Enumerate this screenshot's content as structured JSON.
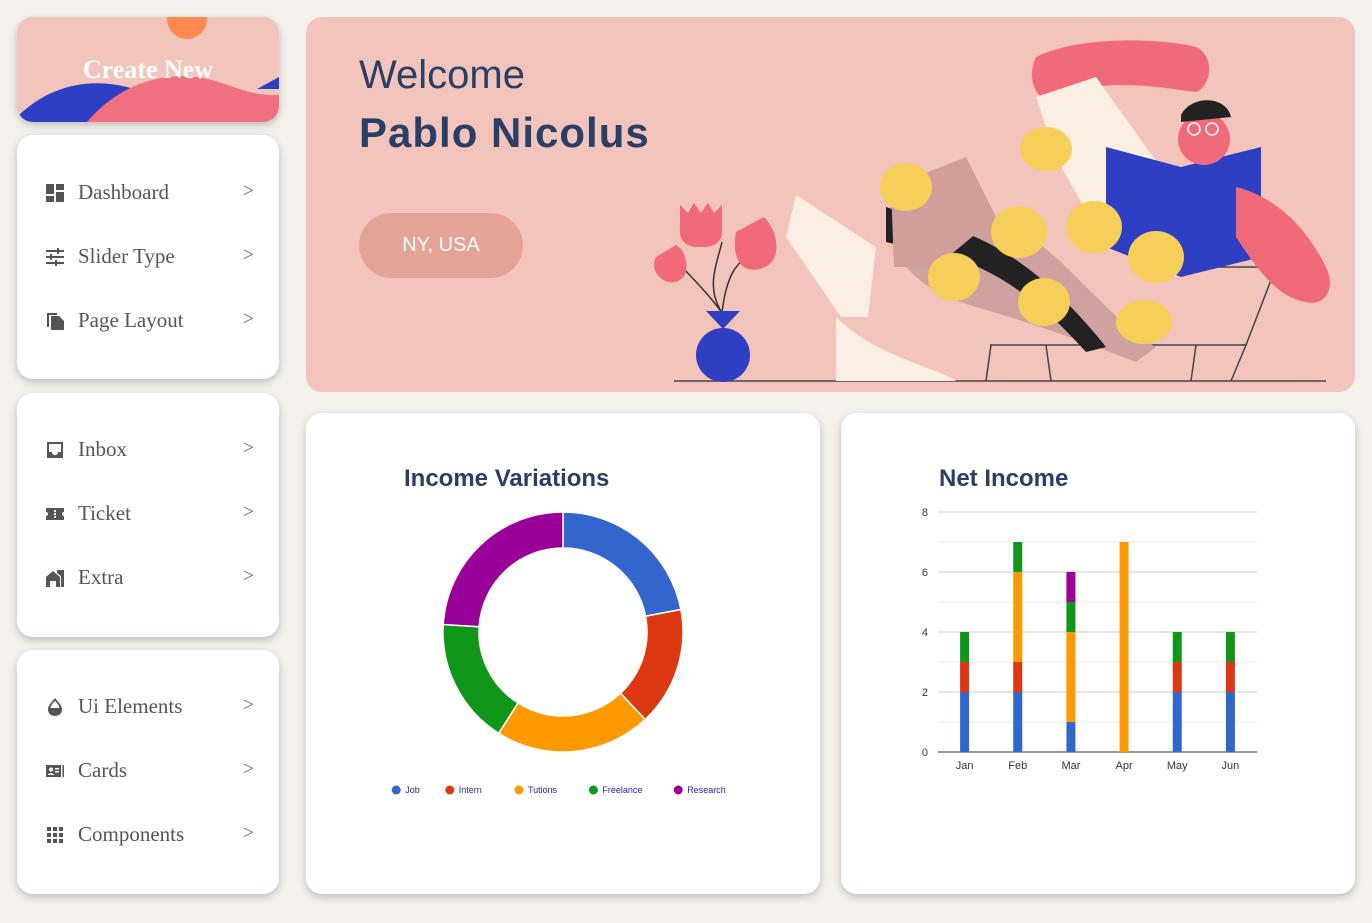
{
  "sidebar": {
    "create_label": "Create New",
    "groups": [
      [
        {
          "label": "Dashboard",
          "icon": "dashboard-icon",
          "arrow": ">"
        },
        {
          "label": "Slider Type",
          "icon": "sliders-icon",
          "arrow": ">"
        },
        {
          "label": "Page Layout",
          "icon": "page-layout-icon",
          "arrow": ">"
        }
      ],
      [
        {
          "label": "Inbox",
          "icon": "inbox-icon",
          "arrow": ">"
        },
        {
          "label": "Ticket",
          "icon": "ticket-icon",
          "arrow": ">"
        },
        {
          "label": "Extra",
          "icon": "house-icon",
          "arrow": ">"
        }
      ],
      [
        {
          "label": "Ui Elements",
          "icon": "drop-icon",
          "arrow": ">"
        },
        {
          "label": "Cards",
          "icon": "contact-card-icon",
          "arrow": ">"
        },
        {
          "label": "Components",
          "icon": "grid-icon",
          "arrow": ">"
        }
      ]
    ]
  },
  "hero": {
    "greeting": "Welcome",
    "name": "Pablo Nicolus",
    "location": "NY, USA"
  },
  "colors": {
    "accent_pink": "#f2c4bb",
    "title_navy": "#2a3f67",
    "button_salmon": "#e5a398"
  },
  "chart_data": [
    {
      "type": "pie",
      "title": "Income Variations",
      "donut": true,
      "categories": [
        "Job",
        "Intern",
        "Tutions",
        "Freelance",
        "Research"
      ],
      "values": [
        22,
        16,
        21,
        17,
        24
      ],
      "colors": [
        "#3366cc",
        "#dc3912",
        "#ff9900",
        "#109618",
        "#990099"
      ],
      "legend": "bottom"
    },
    {
      "type": "bar",
      "stacked": true,
      "title": "Net Income",
      "categories": [
        "Jan",
        "Feb",
        "Mar",
        "Apr",
        "May",
        "Jun"
      ],
      "series": [
        {
          "values": [
            2,
            2,
            1,
            0,
            2,
            2
          ],
          "color": "#3366cc"
        },
        {
          "values": [
            1,
            1,
            0,
            0,
            1,
            1
          ],
          "color": "#dc3912"
        },
        {
          "values": [
            0,
            3,
            3,
            7,
            0,
            0
          ],
          "color": "#ff9900"
        },
        {
          "values": [
            1,
            1,
            1,
            0,
            1,
            1
          ],
          "color": "#109618"
        },
        {
          "values": [
            0,
            0,
            1,
            0,
            0,
            0
          ],
          "color": "#990099"
        }
      ],
      "ylim": [
        0,
        8
      ],
      "yticks": [
        0,
        2,
        4,
        6,
        8
      ],
      "grid": true
    }
  ]
}
